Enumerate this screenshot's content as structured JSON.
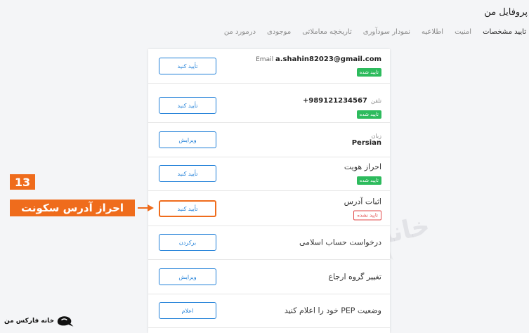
{
  "header": {
    "title": "پروفایل من"
  },
  "tabs": [
    {
      "label": "درمورد من"
    },
    {
      "label": "موجودی"
    },
    {
      "label": "تاریخچه معاملاتی"
    },
    {
      "label": "نمودار سودآوری"
    },
    {
      "label": "اطلاعیه"
    },
    {
      "label": "امنیت"
    },
    {
      "label": "تایید مشخصات"
    }
  ],
  "rows": {
    "email": {
      "label": "Email",
      "value": "a.shahin82023@gmail.com",
      "badge": "تایید شده",
      "button": "تأیید کنید"
    },
    "phone": {
      "label": "تلفن",
      "value": "+989121234567",
      "badge": "تایید شده",
      "button": "تأیید کنید"
    },
    "language": {
      "label": "زبان",
      "value": "Persian",
      "button": "ویرایش"
    },
    "identity": {
      "label": "احراز هویت",
      "badge": "تایید شده",
      "button": "تأیید کنید"
    },
    "address": {
      "label": "اثبات آدرس",
      "badge": "تایید نشده",
      "button": "تأیید کنید"
    },
    "islamic": {
      "label": "درخواست حساب اسلامی",
      "button": "برکردن"
    },
    "referral": {
      "label": "تغییر گروه ارجاع",
      "button": "ویرایش"
    },
    "pep": {
      "label": "وضعیت PEP خود را اعلام کنید",
      "button": "اعلام"
    }
  },
  "annotation": {
    "step": "13",
    "label": "احراز آدرس سکونت"
  },
  "watermark": {
    "text": "خانه فارکس من"
  },
  "logo": {
    "text": "خانه فارکس من"
  },
  "colors": {
    "accent": "#1f7fd8",
    "success": "#2dbb5d",
    "danger": "#e24a4a",
    "annotation": "#ef6c1c"
  }
}
